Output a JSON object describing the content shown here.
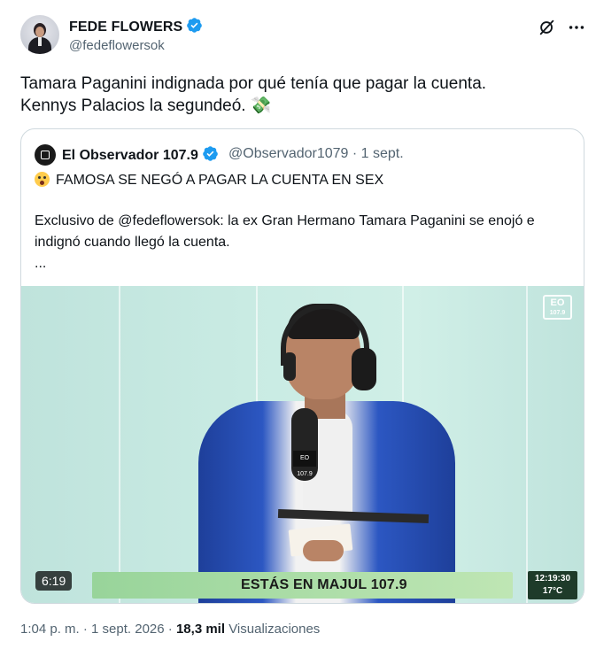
{
  "author": {
    "name": "FEDE FLOWERS",
    "handle": "@fedeflowersok",
    "verified": true
  },
  "tweet": {
    "lines": [
      "Tamara Paganini indignada por qué tenía que pagar la cuenta.",
      "Kennys Palacios la segundeó. 💸"
    ]
  },
  "quote": {
    "name": "El Observador 107.9",
    "handle_meta": "@Observador1079 · 1 sept.",
    "verified": true,
    "headline": "FAMOSA SE NEGÓ A PAGAR LA CUENTA EN SEX",
    "body_lines": [
      "Exclusivo de @fedeflowersok: la ex Gran Hermano Tamara Paganini se enojó e",
      "indignó cuando llegó la cuenta.",
      "..."
    ],
    "video": {
      "duration": "6:19",
      "lower_third": "ESTÁS EN MAJUL 107.9",
      "clock_time": "12:19:30",
      "clock_temp": "17°C",
      "logo_top": "EO",
      "logo_bottom": "107.9",
      "mic_tag": "EO 107.9"
    }
  },
  "meta": {
    "time": "1:04 p. m.",
    "date": "1 sept. 2026",
    "separator": "·",
    "views_count": "18,3 mil",
    "views_label": "Visualizaciones"
  },
  "colors": {
    "verified": "#1d9bf0",
    "secondary_text": "#536471",
    "border": "#cfd9de"
  },
  "icons": [
    "grok-icon",
    "more-icon",
    "verified-badge-icon"
  ]
}
